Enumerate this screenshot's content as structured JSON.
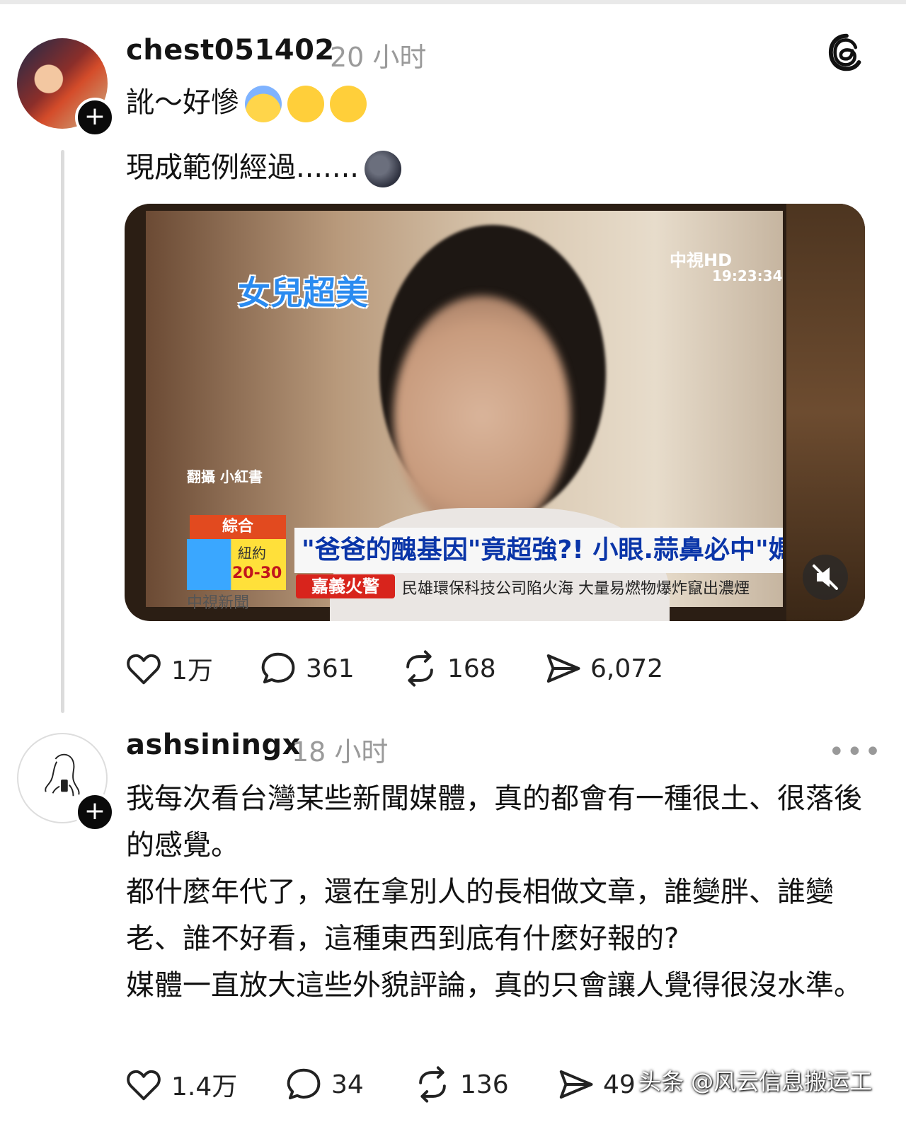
{
  "post": {
    "username": "chest051402",
    "time": "20 小时",
    "line1": "訛～好慘",
    "line2": "現成範例經過.......",
    "media": {
      "tv_title": "女兒超美",
      "channel": "中視HD",
      "clock": "19:23:34",
      "source": "翻攝 小紅書",
      "category": "綜合",
      "weather_city": "紐約",
      "weather_temp": "20-30",
      "headline": "\"爸爸的醜基因\"竟超強?! 小眼.蒜鼻必中\"媽再美也沒用\"!",
      "station": "中視新聞",
      "alert_badge": "嘉義火警",
      "alert_text": "民雄環保科技公司陷火海 大量易燃物爆炸竄出濃煙"
    },
    "stats": {
      "likes": "1万",
      "comments": "361",
      "reposts": "168",
      "shares": "6,072"
    }
  },
  "reply": {
    "username": "ashsiningx",
    "time": "18 小时",
    "text": "我每次看台灣某些新聞媒體，真的都會有一種很土、很落後的感覺。\n都什麼年代了，還在拿別人的長相做文章，誰變胖、誰變老、誰不好看，這種東西到底有什麼好報的?\n媒體一直放大這些外貌評論，真的只會讓人覺得很沒水準。",
    "stats": {
      "likes": "1.4万",
      "comments": "34",
      "reposts": "136",
      "shares": "49"
    }
  },
  "watermark": "头条 @风云信息搬运工",
  "icons": {
    "threads": "threads-logo-icon",
    "like": "heart-icon",
    "comment": "comment-bubble-icon",
    "repost": "repost-icon",
    "share": "send-icon",
    "more": "more-dots-icon",
    "mute": "muted-speaker-icon"
  }
}
